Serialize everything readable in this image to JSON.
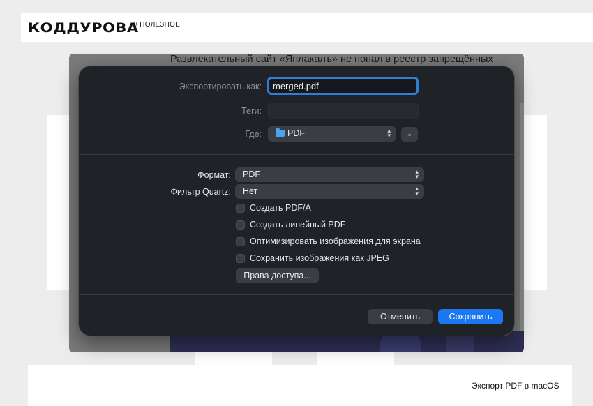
{
  "header": {
    "logo": "КОДДУРОВА",
    "section": "// ПОЛЕЗНОЕ"
  },
  "background_window": {
    "title": "Развлекательный сайт «Яплакалъ» не попал в реестр запрещённых"
  },
  "dialog": {
    "export_as_label": "Экспортировать как:",
    "export_as_value": "merged.pdf",
    "tags_label": "Теги:",
    "tags_value": "",
    "where_label": "Где:",
    "where_value": "PDF",
    "where_icon": "folder-icon",
    "expand_icon": "chevron-down-icon",
    "format_label": "Формат:",
    "format_value": "PDF",
    "quartz_label": "Фильтр Quartz:",
    "quartz_value": "Нет",
    "options": [
      {
        "label": "Создать PDF/A",
        "checked": false
      },
      {
        "label": "Создать линейный PDF",
        "checked": false
      },
      {
        "label": "Оптимизировать изображения для экрана",
        "checked": false
      },
      {
        "label": "Сохранить изображения как JPEG",
        "checked": false
      }
    ],
    "permissions_button": "Права доступа...",
    "cancel_button": "Отменить",
    "save_button": "Сохранить",
    "accent_color": "#1b78f2"
  },
  "caption": "Экспорт PDF в macOS"
}
